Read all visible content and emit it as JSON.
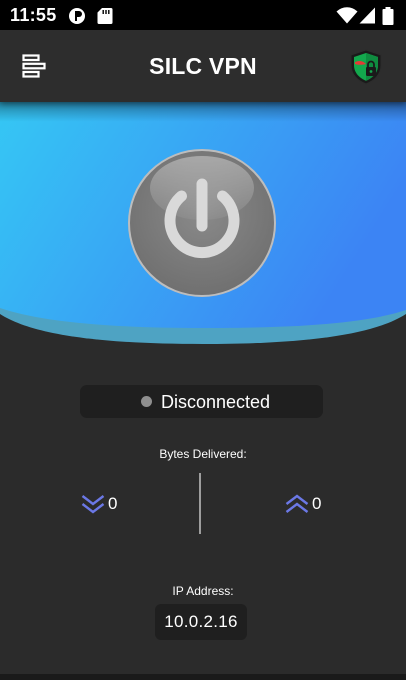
{
  "status_bar": {
    "time": "11:55",
    "left_icons": [
      "profile-icon",
      "sd-card-icon"
    ],
    "right_icons": [
      "wifi-icon",
      "signal-icon",
      "battery-icon"
    ]
  },
  "app_bar": {
    "title": "SILC VPN",
    "menu_icon": "menu-icon",
    "shield_icon": "shield-lock-icon"
  },
  "connection": {
    "status": "Disconnected",
    "status_color": "#8f8f8f",
    "power_icon": "power-icon"
  },
  "bytes": {
    "label": "Bytes Delivered:",
    "downloaded": "0",
    "uploaded": "0",
    "download_icon": "double-chevron-down-icon",
    "upload_icon": "double-chevron-up-icon",
    "icon_color": "#6b78e6"
  },
  "ip": {
    "label": "IP Address:",
    "value": "10.0.2.16"
  },
  "theme": {
    "hero_gradient_start": "#35c7f4",
    "hero_gradient_end": "#3c84f4",
    "background": "#2b2b2b"
  }
}
